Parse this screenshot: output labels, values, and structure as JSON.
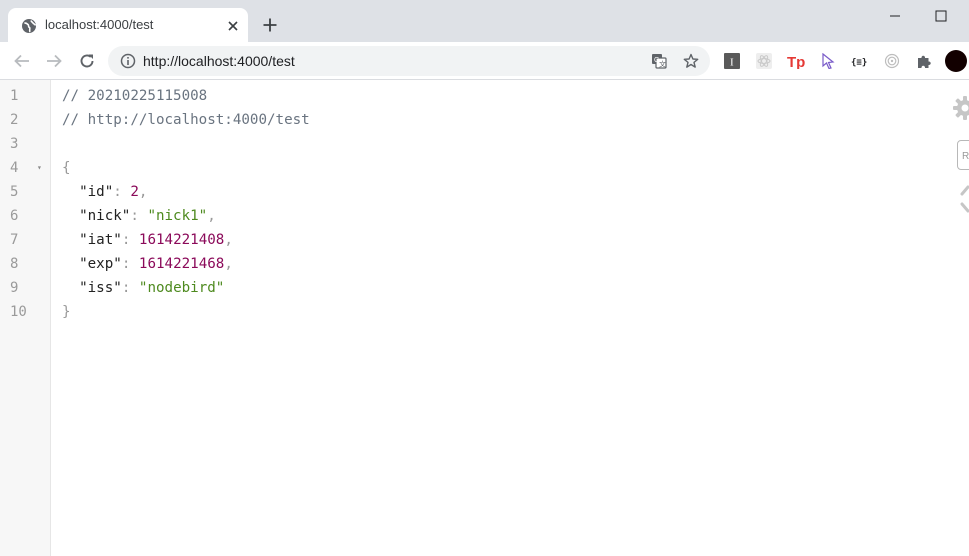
{
  "browser": {
    "tab": {
      "title": "localhost:4000/test",
      "favicon": "globe-icon",
      "close_icon": "close-icon"
    },
    "new_tab_icon": "plus-icon",
    "window_controls": [
      "minimize-icon",
      "maximize-icon"
    ],
    "toolbar": {
      "back_icon": "back-arrow-icon",
      "forward_icon": "forward-arrow-icon",
      "reload_icon": "reload-icon",
      "url": "http://localhost:4000/test",
      "site_info_icon": "info-icon",
      "translate_icon": "translate-icon",
      "bookmark_icon": "star-icon",
      "extensions": [
        "instapaper-icon",
        "react-devtools-icon",
        "tp-icon",
        "cursor-icon",
        "json-viewer-icon",
        "redux-icon",
        "puzzle-icon"
      ],
      "tp_label": "Tp",
      "json_label": "{≡}",
      "instapaper_label": "I"
    }
  },
  "colors": {
    "comment": "#6a7480",
    "number": "#8b0a5a",
    "string": "#4e8a1f",
    "tab_strip": "#dee1e6"
  },
  "viewer": {
    "lines": [
      {
        "n": "1",
        "comment": "// 20210225115008"
      },
      {
        "n": "2",
        "comment": "// http://localhost:4000/test"
      },
      {
        "n": "3"
      },
      {
        "n": "4",
        "open": "{",
        "foldable": true
      },
      {
        "n": "5",
        "key": "\"id\"",
        "sep": ": ",
        "value": "2",
        "type": "number",
        "comma": ","
      },
      {
        "n": "6",
        "key": "\"nick\"",
        "sep": ": ",
        "value": "\"nick1\"",
        "type": "string",
        "comma": ","
      },
      {
        "n": "7",
        "key": "\"iat\"",
        "sep": ": ",
        "value": "1614221408",
        "type": "number",
        "comma": ","
      },
      {
        "n": "8",
        "key": "\"exp\"",
        "sep": ": ",
        "value": "1614221468",
        "type": "number",
        "comma": ","
      },
      {
        "n": "9",
        "key": "\"iss\"",
        "sep": ": ",
        "value": "\"nodebird\"",
        "type": "string",
        "comma": ""
      },
      {
        "n": "10",
        "close": "}"
      }
    ],
    "fold_marker": "▾",
    "side_tools": [
      "gear-icon",
      "raw-toggle-icon",
      "collapse-icon"
    ],
    "raw_label": "R"
  }
}
